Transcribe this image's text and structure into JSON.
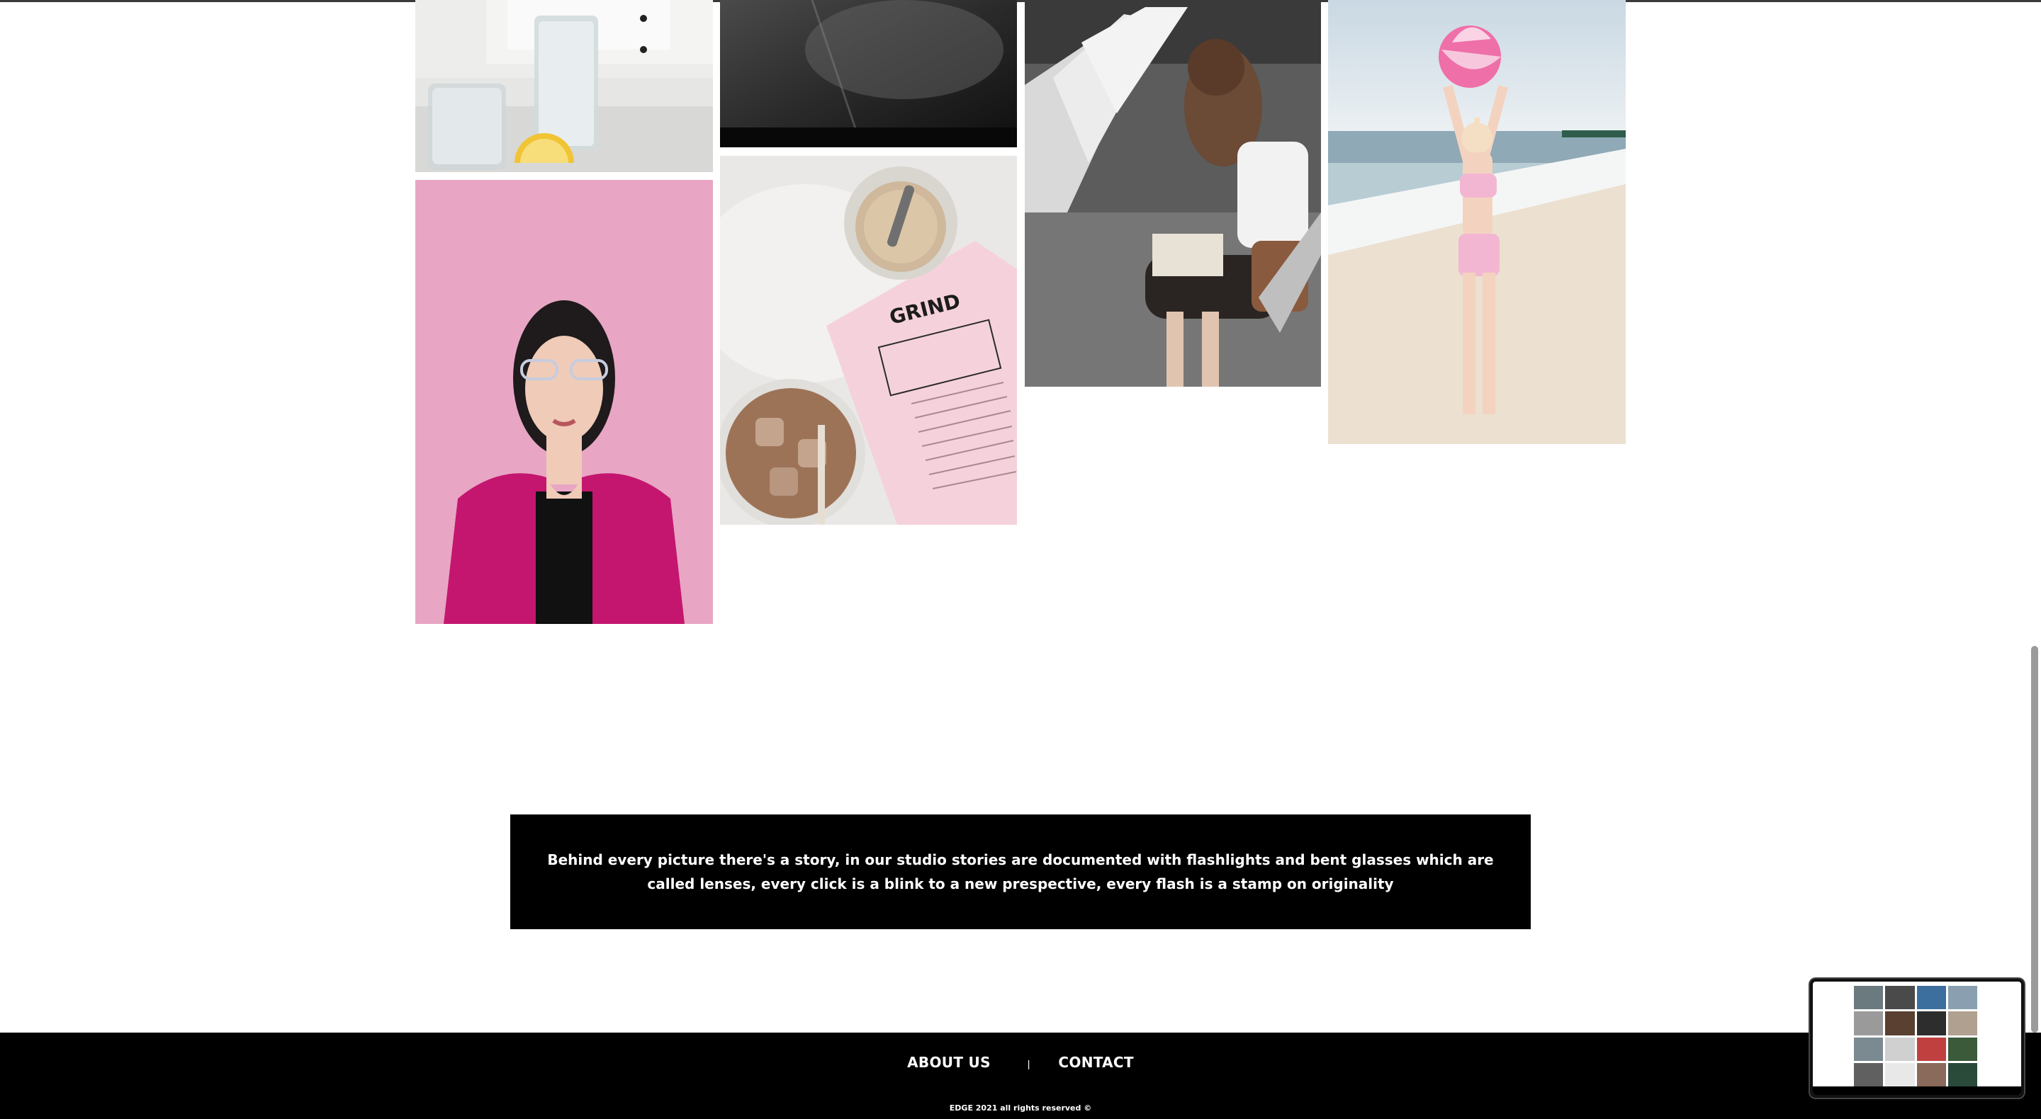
{
  "story": {
    "text": "Behind every picture there's a story, in our studio stories are documented with flashlights and bent glasses which are called lenses, every click is a blink to a new prespective, every flash is a stamp on originality"
  },
  "footer": {
    "about_label": "ABOUT US",
    "separator": "|",
    "contact_label": "CONTACT",
    "copyright": "EDGE 2021 all rights reserved ©"
  },
  "gallery": {
    "photos": [
      {
        "name": "water-glass-lemon-photo"
      },
      {
        "name": "dark-road-photo"
      },
      {
        "name": "woman-reading-photo"
      },
      {
        "name": "beach-ball-woman-photo"
      },
      {
        "name": "pink-blazer-woman-photo"
      },
      {
        "name": "grind-menu-coffee-photo"
      }
    ],
    "menu_print": "GRIND"
  },
  "colors": {
    "banner_bg": "#000000",
    "footer_bg": "#000000",
    "accent_pink": "#e8a6c4",
    "blazer_magenta": "#c4166f"
  }
}
